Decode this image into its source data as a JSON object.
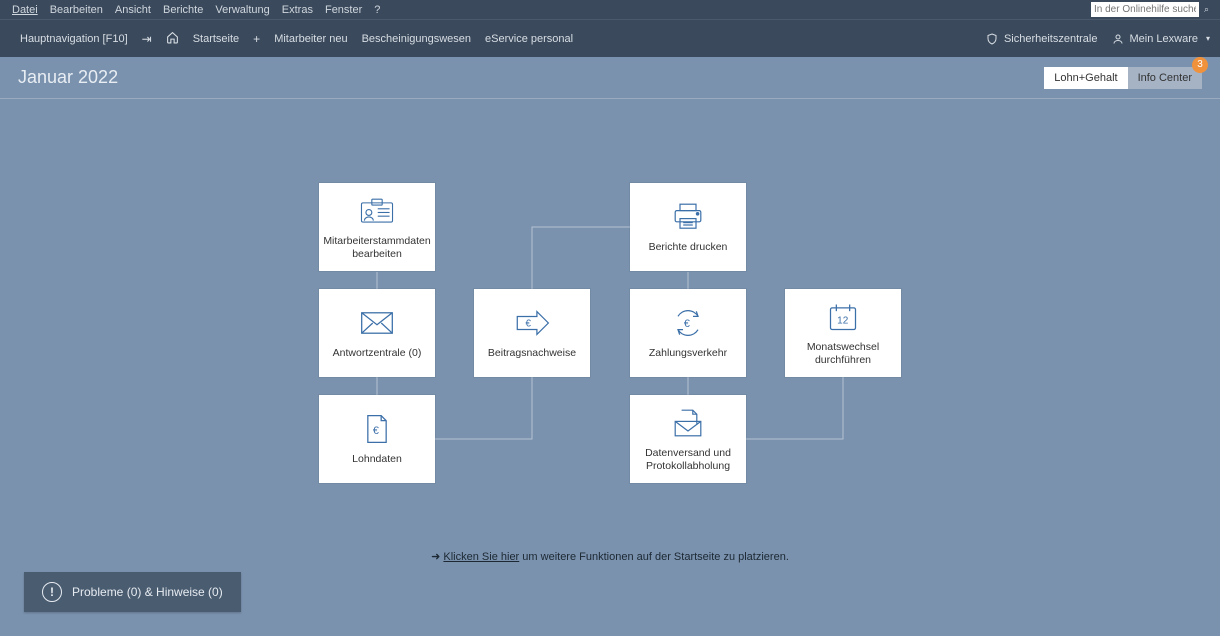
{
  "menubar": {
    "items": [
      "Datei",
      "Bearbeiten",
      "Ansicht",
      "Berichte",
      "Verwaltung",
      "Extras",
      "Fenster",
      "?"
    ],
    "search_placeholder": "In der Onlinehilfe suchen"
  },
  "toolbar": {
    "nav_label": "Hauptnavigation [F10]",
    "home": "Startseite",
    "link1": "Mitarbeiter neu",
    "link2": "Bescheinigungswesen",
    "link3": "eService personal",
    "security": "Sicherheitszentrale",
    "account": "Mein Lexware"
  },
  "page": {
    "title": "Januar 2022",
    "tab_active": "Lohn+Gehalt",
    "tab_inactive": "Info Center",
    "badge": "3"
  },
  "tiles": {
    "t1": "Mitarbeiterstammdaten bearbeiten",
    "t2": "Berichte drucken",
    "t3": "Antwortzentrale (0)",
    "t4": "Beitragsnachweise",
    "t5": "Zahlungsverkehr",
    "t6": "Monatswechsel durchführen",
    "t7": "Lohndaten",
    "t8": "Datenversand und Protokollabholung",
    "calendar_day": "12"
  },
  "hint": {
    "prefix": "➜",
    "link": "Klicken Sie hier",
    "suffix": " um weitere Funktionen auf der Startseite zu platzieren."
  },
  "status": {
    "label": "Probleme (0) & Hinweise (0)"
  }
}
